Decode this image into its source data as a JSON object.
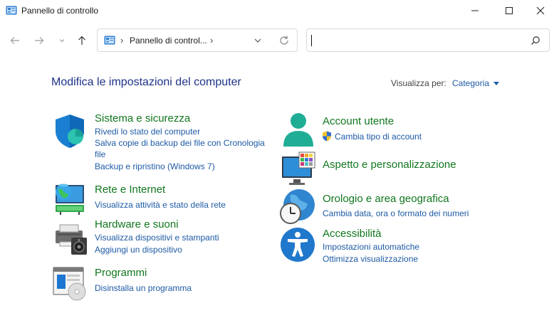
{
  "window": {
    "title": "Pannello di controllo",
    "icons": {
      "app": "control-panel-icon",
      "minimize": "minimize-icon",
      "maximize": "maximize-icon",
      "close": "close-icon"
    }
  },
  "nav": {
    "icons": [
      "arrow-left-icon",
      "arrow-right-icon",
      "chevron-down-icon",
      "arrow-up-icon"
    ],
    "address": {
      "path": "Pannello di control...",
      "separator": "›"
    },
    "search": {
      "value": "",
      "placeholder": ""
    }
  },
  "content": {
    "title": "Modifica le impostazioni del computer",
    "view_by": {
      "label": "Visualizza per:",
      "value": "Categoria"
    }
  },
  "categories": [
    {
      "title": "Sistema e sicurezza",
      "icon": "shield-icon",
      "links": [
        "Rivedi lo stato del computer",
        "Salva copie di backup dei file con Cronologia file",
        "Backup e ripristino (Windows 7)"
      ]
    },
    {
      "title": "Rete e Internet",
      "icon": "network-globe-icon",
      "links": [
        "Visualizza attività e stato della rete"
      ]
    },
    {
      "title": "Hardware e suoni",
      "icon": "printer-speaker-icon",
      "links": [
        "Visualizza dispositivi e stampanti",
        "Aggiungi un dispositivo"
      ]
    },
    {
      "title": "Programmi",
      "icon": "programs-disc-icon",
      "links": [
        "Disinstalla un programma"
      ]
    },
    {
      "title": "Account utente",
      "icon": "user-account-icon",
      "links": [
        "Cambia tipo di account"
      ]
    },
    {
      "title": "Aspetto e personalizzazione",
      "icon": "monitor-palette-icon",
      "links": []
    },
    {
      "title": "Orologio e area geografica",
      "icon": "clock-globe-icon",
      "links": [
        "Cambia data, ora o formato dei numeri"
      ]
    },
    {
      "title": "Accessibilità",
      "icon": "accessibility-icon",
      "links": [
        "Impostazioni automatiche",
        "Ottimizza visualizzazione"
      ]
    }
  ],
  "colors": {
    "category_title": "#10771d",
    "link": "#1d5aa5",
    "page_title": "#1e3287"
  }
}
